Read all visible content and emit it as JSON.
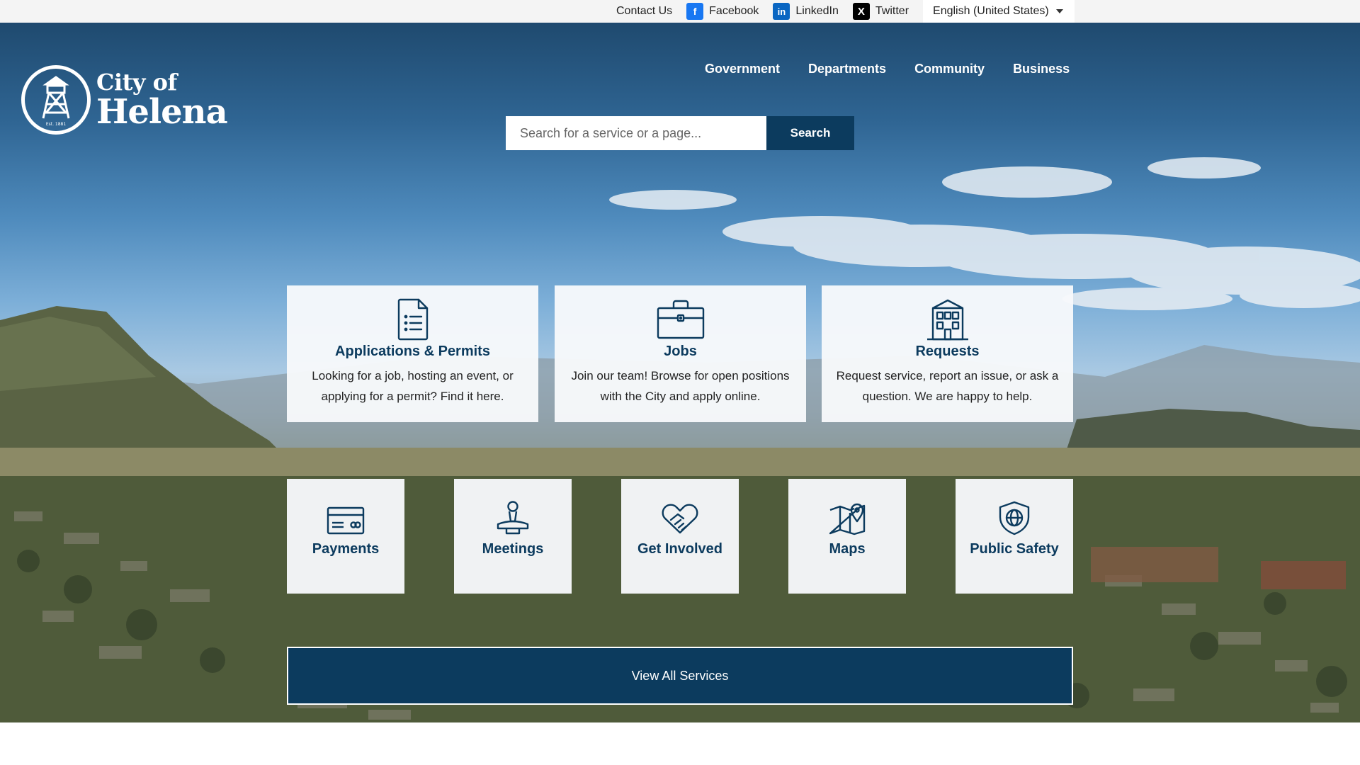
{
  "utility": {
    "contact": "Contact Us",
    "facebook": "Facebook",
    "linkedin": "LinkedIn",
    "twitter": "Twitter",
    "language": "English (United States)"
  },
  "logo": {
    "line1": "City of",
    "line2": "Helena",
    "seal_text": "Est. 1881"
  },
  "nav": [
    "Government",
    "Departments",
    "Community",
    "Business"
  ],
  "search": {
    "placeholder": "Search for a service or a page...",
    "button": "Search"
  },
  "cards": [
    {
      "title": "Applications & Permits",
      "desc": "Looking for a job, hosting an event, or applying for a permit? Find it here.",
      "icon": "document-list-icon"
    },
    {
      "title": "Jobs",
      "desc": "Join our team! Browse for open positions with the City and apply online.",
      "icon": "briefcase-icon"
    },
    {
      "title": "Requests",
      "desc": "Request service, report an issue, or ask a question. We are happy to help.",
      "icon": "building-icon"
    }
  ],
  "quick_links": [
    {
      "title": "Payments",
      "icon": "credit-card-icon"
    },
    {
      "title": "Meetings",
      "icon": "podium-icon"
    },
    {
      "title": "Get Involved",
      "icon": "handshake-heart-icon"
    },
    {
      "title": "Maps",
      "icon": "map-pin-icon"
    },
    {
      "title": "Public Safety",
      "icon": "globe-shield-icon"
    }
  ],
  "view_all": "View All Services",
  "colors": {
    "brand": "#0c3b5e",
    "utility_bg": "#f4f4f4"
  }
}
